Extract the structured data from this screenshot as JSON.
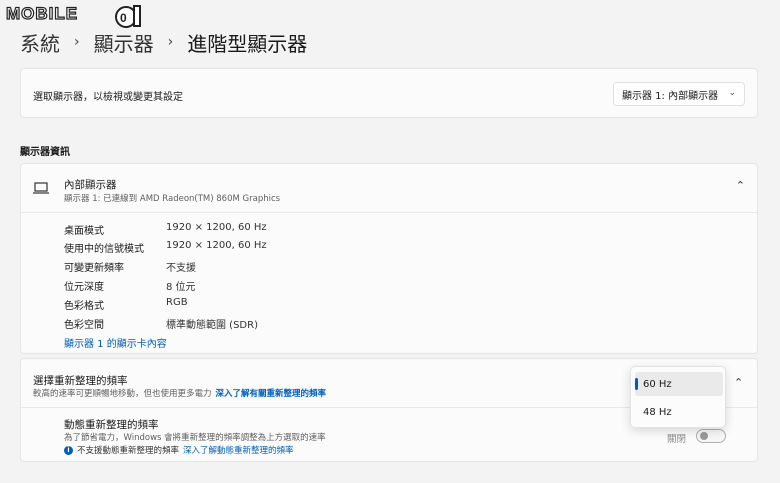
{
  "watermark": {
    "logo_text": "MOBILE01"
  },
  "breadcrumb": {
    "items": [
      "系統",
      "顯示器",
      "進階型顯示器"
    ],
    "separator": "›"
  },
  "select_display": {
    "label": "選取顯示器，以檢視或變更其設定",
    "selected": "顯示器 1: 內部顯示器"
  },
  "display_info": {
    "heading": "顯示器資訊",
    "title": "內部顯示器",
    "subtitle": "顯示器 1: 已連線到 AMD Radeon(TM) 860M Graphics",
    "properties": [
      {
        "key": "桌面模式",
        "value": "1920 × 1200, 60 Hz"
      },
      {
        "key": "使用中的信號模式",
        "value": "1920 × 1200, 60 Hz"
      },
      {
        "key": "可變更新頻率",
        "value": "不支援"
      },
      {
        "key": "位元深度",
        "value": "8 位元"
      },
      {
        "key": "色彩格式",
        "value": "RGB"
      },
      {
        "key": "色彩空間",
        "value": "標準動態範圍 (SDR)"
      }
    ],
    "adapter_link": "顯示器 1 的顯示卡內容"
  },
  "refresh_rate": {
    "title": "選擇重新整理的頻率",
    "description": "較高的速率可更順暢地移動，但也使用更多電力",
    "learn_more": "深入了解有關重新整理的頻率",
    "options": [
      "60 Hz",
      "48 Hz"
    ],
    "selected": "60 Hz",
    "dynamic": {
      "title": "動態重新整理的頻率",
      "description": "為了節省電力，Windows 會將重新整理的頻率調整為上方選取的速率",
      "note": "不支援動態重新整理的頻率",
      "note_link": "深入了解動態重新整理的頻率",
      "toggle_label": "關閉",
      "toggle_on": false
    }
  },
  "colors": {
    "accent": "#005fb8",
    "background": "#f3f3f3",
    "card": "#fbfbfb"
  }
}
